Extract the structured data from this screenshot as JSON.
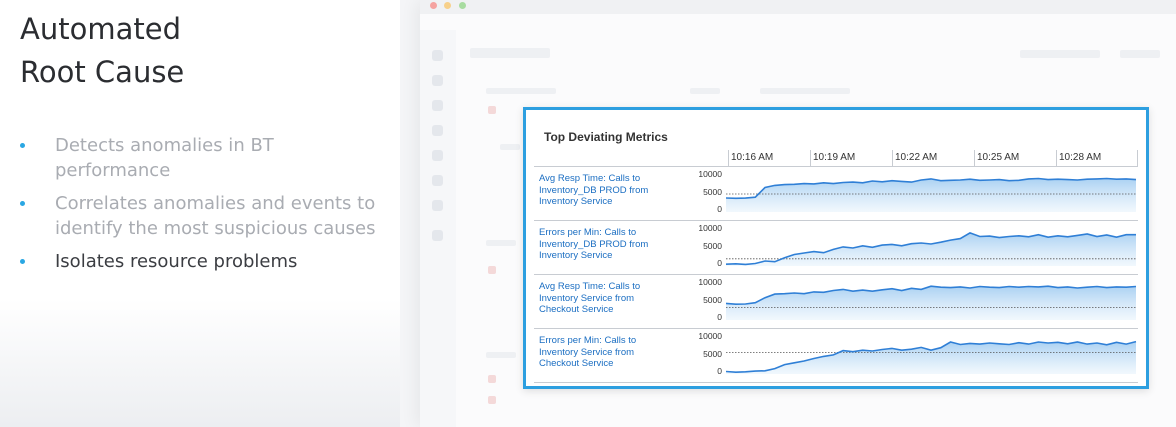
{
  "slide": {
    "title_line1": "Automated",
    "title_line2": "Root Cause",
    "bullets": [
      {
        "text": "Detects anomalies in BT performance",
        "active": false
      },
      {
        "text": "Correlates anomalies and events to identify the most suspicious causes",
        "active": false
      },
      {
        "text": "Isolates resource problems",
        "active": true
      }
    ],
    "bullet_color": "#2aa7e3"
  },
  "panel": {
    "title": "Top Deviating Metrics",
    "accent_color": "#2d9fe0",
    "time_ticks": [
      "10:16 AM",
      "10:19 AM",
      "10:22 AM",
      "10:25 AM",
      "10:28 AM"
    ],
    "y_ticks": [
      "10000",
      "5000",
      "0"
    ],
    "y_max": 10000,
    "metrics": [
      {
        "label": "Avg Resp Time: Calls to Inventory_DB PROD from Inventory Service",
        "baseline": 5000,
        "values": [
          3900,
          3800,
          3850,
          4100,
          6800,
          7400,
          7600,
          7700,
          7900,
          7800,
          8100,
          7900,
          8200,
          8300,
          8100,
          8600,
          8400,
          8700,
          8500,
          8300,
          8900,
          9200,
          8700,
          8800,
          8900,
          9100,
          8800,
          8900,
          9000,
          8700,
          8800,
          9200,
          9300,
          9000,
          9100,
          9000,
          8900,
          9100,
          9200,
          9300,
          9100,
          9200,
          9000
        ]
      },
      {
        "label": "Errors per Min: Calls to Inventory_DB PROD from Inventory Service",
        "baseline": 2000,
        "values": [
          500,
          600,
          450,
          700,
          1400,
          1200,
          2300,
          3200,
          3600,
          4000,
          3700,
          4600,
          5300,
          5000,
          5600,
          5200,
          5800,
          6000,
          5600,
          6200,
          6400,
          6100,
          6600,
          7200,
          7600,
          9200,
          8200,
          8300,
          7900,
          8200,
          8400,
          8100,
          8700,
          8000,
          8400,
          8100,
          8500,
          8900,
          8200,
          8600,
          8000,
          8700,
          8700
        ]
      },
      {
        "label": "Avg Resp Time: Calls to Inventory Service from Checkout Service",
        "baseline": 3500,
        "values": [
          4600,
          4400,
          4450,
          4800,
          6200,
          7200,
          7300,
          7500,
          7300,
          7800,
          7700,
          8200,
          8500,
          8000,
          8300,
          8000,
          8400,
          8700,
          8200,
          8800,
          8500,
          9400,
          9100,
          9000,
          9200,
          8900,
          9300,
          9100,
          9000,
          9300,
          9100,
          9300,
          9200,
          9400,
          9000,
          9200,
          8900,
          9100,
          9300,
          9000,
          9200,
          9100,
          9300
        ]
      },
      {
        "label": "Errors per Min: Calls to Inventory Service from Checkout Service",
        "baseline": 6000,
        "values": [
          700,
          500,
          600,
          800,
          900,
          1500,
          2600,
          3100,
          3600,
          4300,
          4900,
          5300,
          6500,
          6200,
          6600,
          6400,
          6800,
          7100,
          6600,
          6900,
          7400,
          6600,
          7300,
          8900,
          8200,
          8500,
          8300,
          8600,
          8400,
          8200,
          8700,
          8300,
          8900,
          8600,
          8800,
          8400,
          8900,
          8300,
          8600,
          8100,
          8800,
          8300,
          9000
        ]
      }
    ]
  }
}
